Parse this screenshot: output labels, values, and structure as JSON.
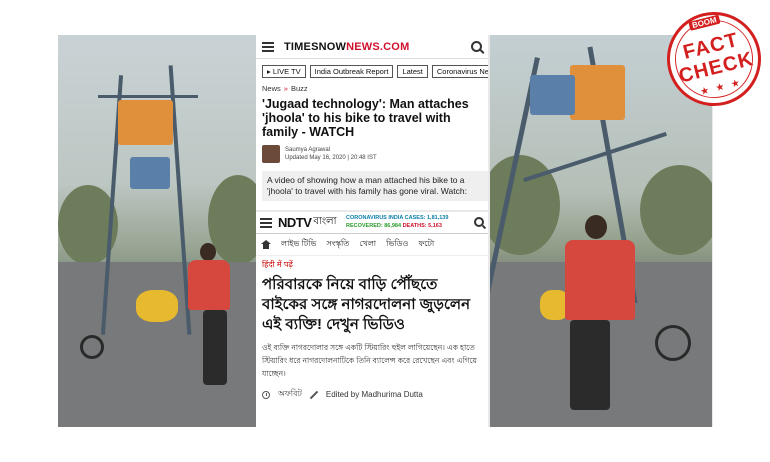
{
  "times": {
    "logo_prefix": "TIMESNOW",
    "logo_suffix": "NEWS.COM",
    "pills": [
      "▸ LIVE TV",
      "India Outbreak Report",
      "Latest",
      "Coronavirus News"
    ],
    "crumbs": [
      "News",
      "Buzz"
    ],
    "headline": "'Jugaad technology': Man attaches 'jhoola' to his bike to travel with family - WATCH",
    "author": "Saumya Agrawal",
    "updated": "Updated May 16, 2020 | 20:48 IST",
    "summary": "A video of showing how a man attached his bike to a 'jhoola' to travel with his family has gone viral. Watch:"
  },
  "ndtv": {
    "logo": "NDTV",
    "lang": "বাংলা",
    "ticker_cases": "CORONAVIRUS INDIA CASES: 1,81,139",
    "ticker_recovered": "RECOVERED: 86,984",
    "ticker_deaths": "DEATHS: 5,163",
    "nav": [
      "লাইভ টিভি",
      "সংস্কৃতি",
      "খেলা",
      "ভিডিও",
      "ফটো"
    ],
    "hindi_link": "हिंदी में पढ़ें",
    "headline": "পরিবারকে নিয়ে বাড়ি পৌঁছতে বাইকের সঙ্গে নাগরদোলনা জুড়লেন এই ব্যক্তি! দেখুন ভিডিও",
    "body": "ওই ব্যক্তি নাগরদোলার সঙ্গে একটি স্টিয়ারিং হুইল লাগিয়েছেন। এক হাতে স্টিয়ারিং ধরে নাগরদোলনাটিকে তিনি ব্যালেন্স করে রেখেছেন এবং এগিয়ে যাচ্ছেন।",
    "category": "অফবিট",
    "editor": "Edited by Madhurima Dutta"
  },
  "stamp": {
    "brand": "BOOM",
    "line1": "FACT",
    "line2": "CHECK",
    "stars": "★ ★ ★"
  },
  "colors": {
    "stamp_red": "#d41f1f",
    "times_red": "#d0102c",
    "ndtv_red": "#cc1111"
  }
}
